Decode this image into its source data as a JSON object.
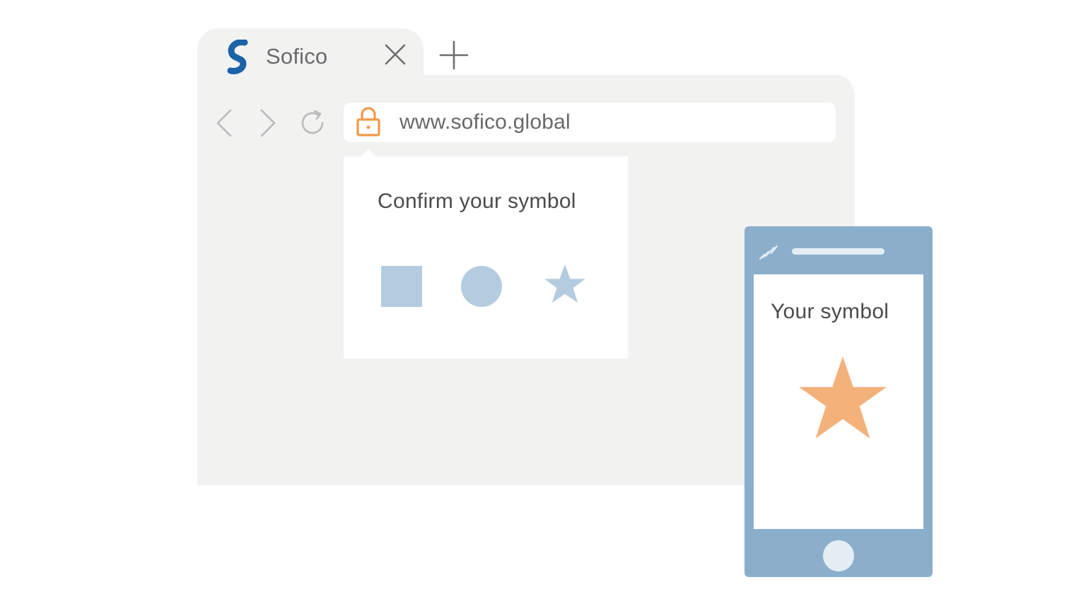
{
  "browser": {
    "tab": {
      "title": "Sofico",
      "logo_icon": "sofico-s-logo",
      "close_icon": "close-icon",
      "new_tab_icon": "plus-icon"
    },
    "nav": {
      "back_icon": "chevron-left-icon",
      "forward_icon": "chevron-right-icon",
      "reload_icon": "reload-icon"
    },
    "address_bar": {
      "url": "www.sofico.global",
      "lock_icon": "lock-icon"
    },
    "popup": {
      "title": "Confirm your symbol",
      "symbols": [
        "square",
        "circle",
        "star"
      ]
    }
  },
  "phone": {
    "title": "Your symbol",
    "symbol": "star",
    "signal_icon": "signal-icon"
  },
  "colors": {
    "frame": "#f2f2f1",
    "accent_blue": "#8bafcb",
    "symbol_blue": "#b4cce0",
    "accent_orange": "#f4b27a",
    "lock_orange": "#ef9a48",
    "logo_blue": "#1a63a8"
  }
}
